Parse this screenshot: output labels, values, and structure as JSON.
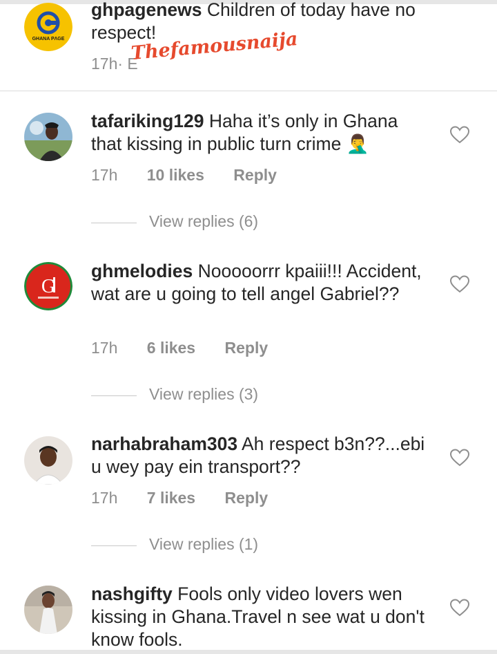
{
  "comments": [
    {
      "username": "ghpagenews",
      "text": " Children of today have no respect!",
      "time": "17h",
      "meta_suffix": " · E",
      "avatar_icon": "ghana-page-logo",
      "avatar_label": "GHANA PɅGE"
    },
    {
      "username": "tafariking129",
      "text": " Haha it’s only in Ghana that kissing in public turn crime 🤦‍♂️",
      "time": "17h",
      "likes": "10 likes",
      "reply": "Reply",
      "view_replies": "View replies (6)",
      "avatar_icon": "user-photo"
    },
    {
      "username": "ghmelodies",
      "text": " Nooooorrr kpaiii!!! Accident, wat are u going to tell angel Gabriel??",
      "time": "17h",
      "likes": "6 likes",
      "reply": "Reply",
      "view_replies": "View replies (3)",
      "avatar_icon": "gh-melodies-logo"
    },
    {
      "username": "narhabraham303",
      "text": " Ah respect b3n??...ebi u wey pay ein transport??",
      "time": "17h",
      "likes": "7 likes",
      "reply": "Reply",
      "view_replies": "View replies (1)",
      "avatar_icon": "user-photo"
    },
    {
      "username": "nashgifty",
      "text": " Fools only video lovers wen kissing in Ghana.Travel n see wat u don't know fools.",
      "avatar_icon": "user-photo"
    }
  ],
  "watermark": "Thefamousnaija",
  "colors": {
    "text": "#262626",
    "muted": "#8e8e8e",
    "watermark": "#e64a2e",
    "ghana_yellow": "#f6c200",
    "melodies_red": "#d9261c"
  }
}
